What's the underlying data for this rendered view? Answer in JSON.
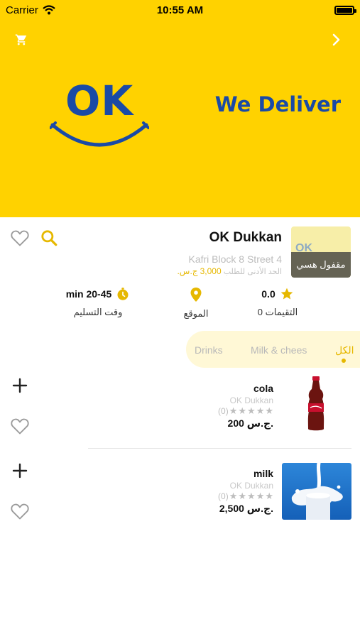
{
  "status_bar": {
    "carrier": "Carrier",
    "time": "10:55 AM"
  },
  "banner": {
    "logo_text": "OK",
    "tagline": "We Deliver"
  },
  "store": {
    "name": "OK Dukkan",
    "address": "Kafri Block 8 Street 4",
    "min_order_label": "الحد الأدنى للطلب",
    "min_order_amount": "3,000",
    "currency": "ج.س.",
    "status": "مقفول هسي",
    "thumb_text": "OK"
  },
  "info": {
    "rating_value": "0.0",
    "rating_label": "0 التقيمات",
    "location_label": "الموقع",
    "delivery_value": "min 20-45",
    "delivery_label": "وقت التسليم"
  },
  "tabs": [
    {
      "label": "الكل",
      "active": true
    },
    {
      "label": "Milk & chees",
      "active": false
    },
    {
      "label": "Drinks",
      "active": false
    }
  ],
  "products": [
    {
      "name": "cola",
      "store": "OK Dukkan",
      "rating_count": "(0)",
      "price": "200 ج.س."
    },
    {
      "name": "milk",
      "store": "OK Dukkan",
      "rating_count": "(0)",
      "price": "2,500 ج.س."
    }
  ],
  "colors": {
    "brand_yellow": "#ffd200",
    "brand_blue": "#1a4aa6",
    "accent": "#e6b800"
  }
}
